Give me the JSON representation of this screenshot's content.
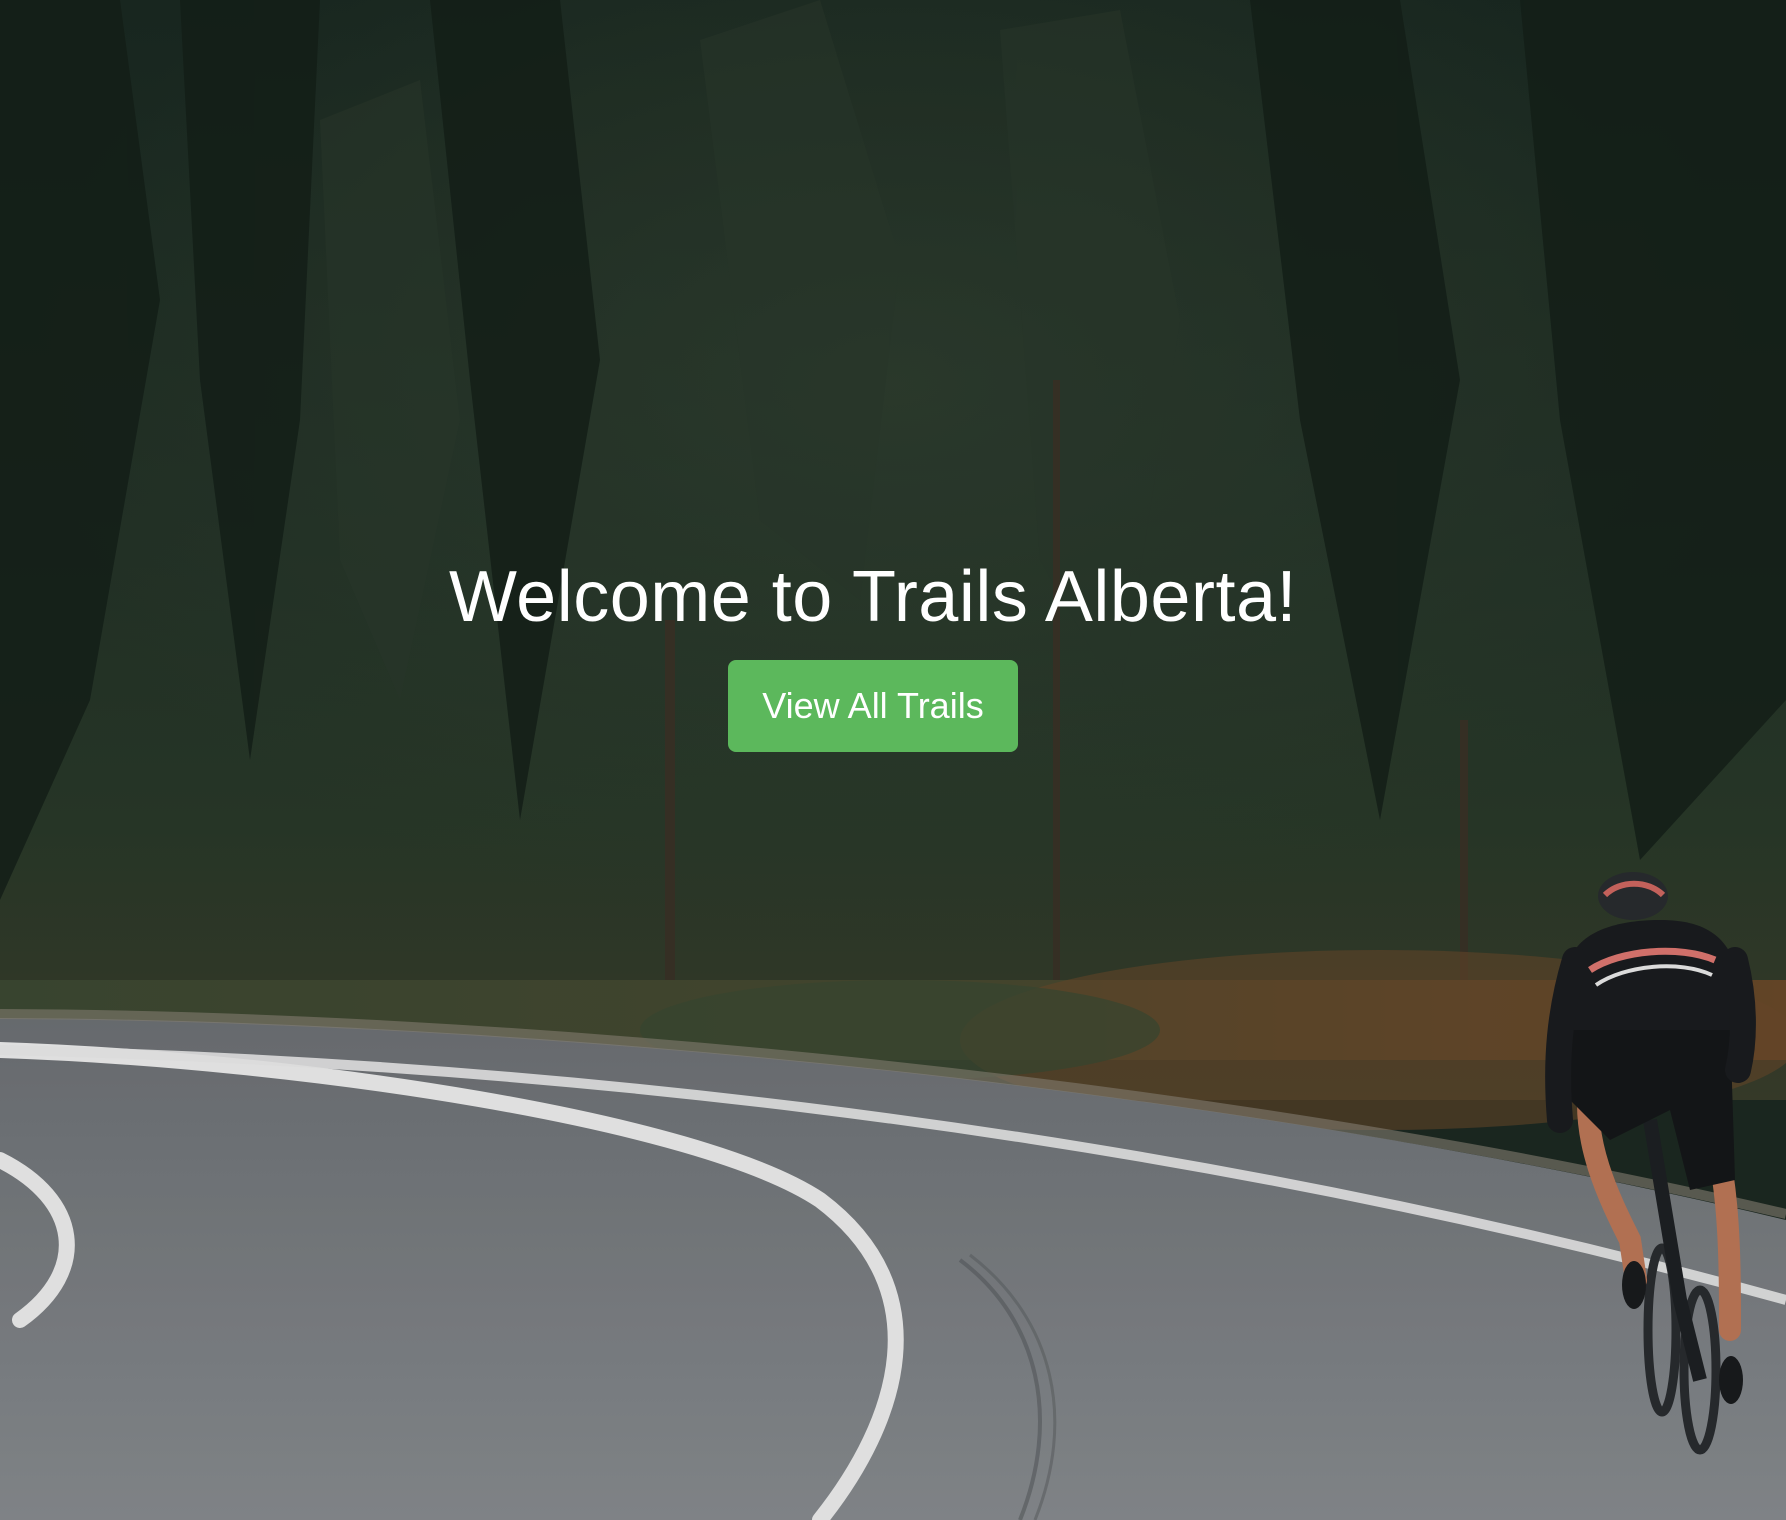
{
  "hero": {
    "title": "Welcome to Trails Alberta!",
    "button_label": "View All Trails",
    "background": "forest-road-cyclist-photo"
  },
  "colors": {
    "button": "#5cb85c",
    "text": "#ffffff"
  }
}
